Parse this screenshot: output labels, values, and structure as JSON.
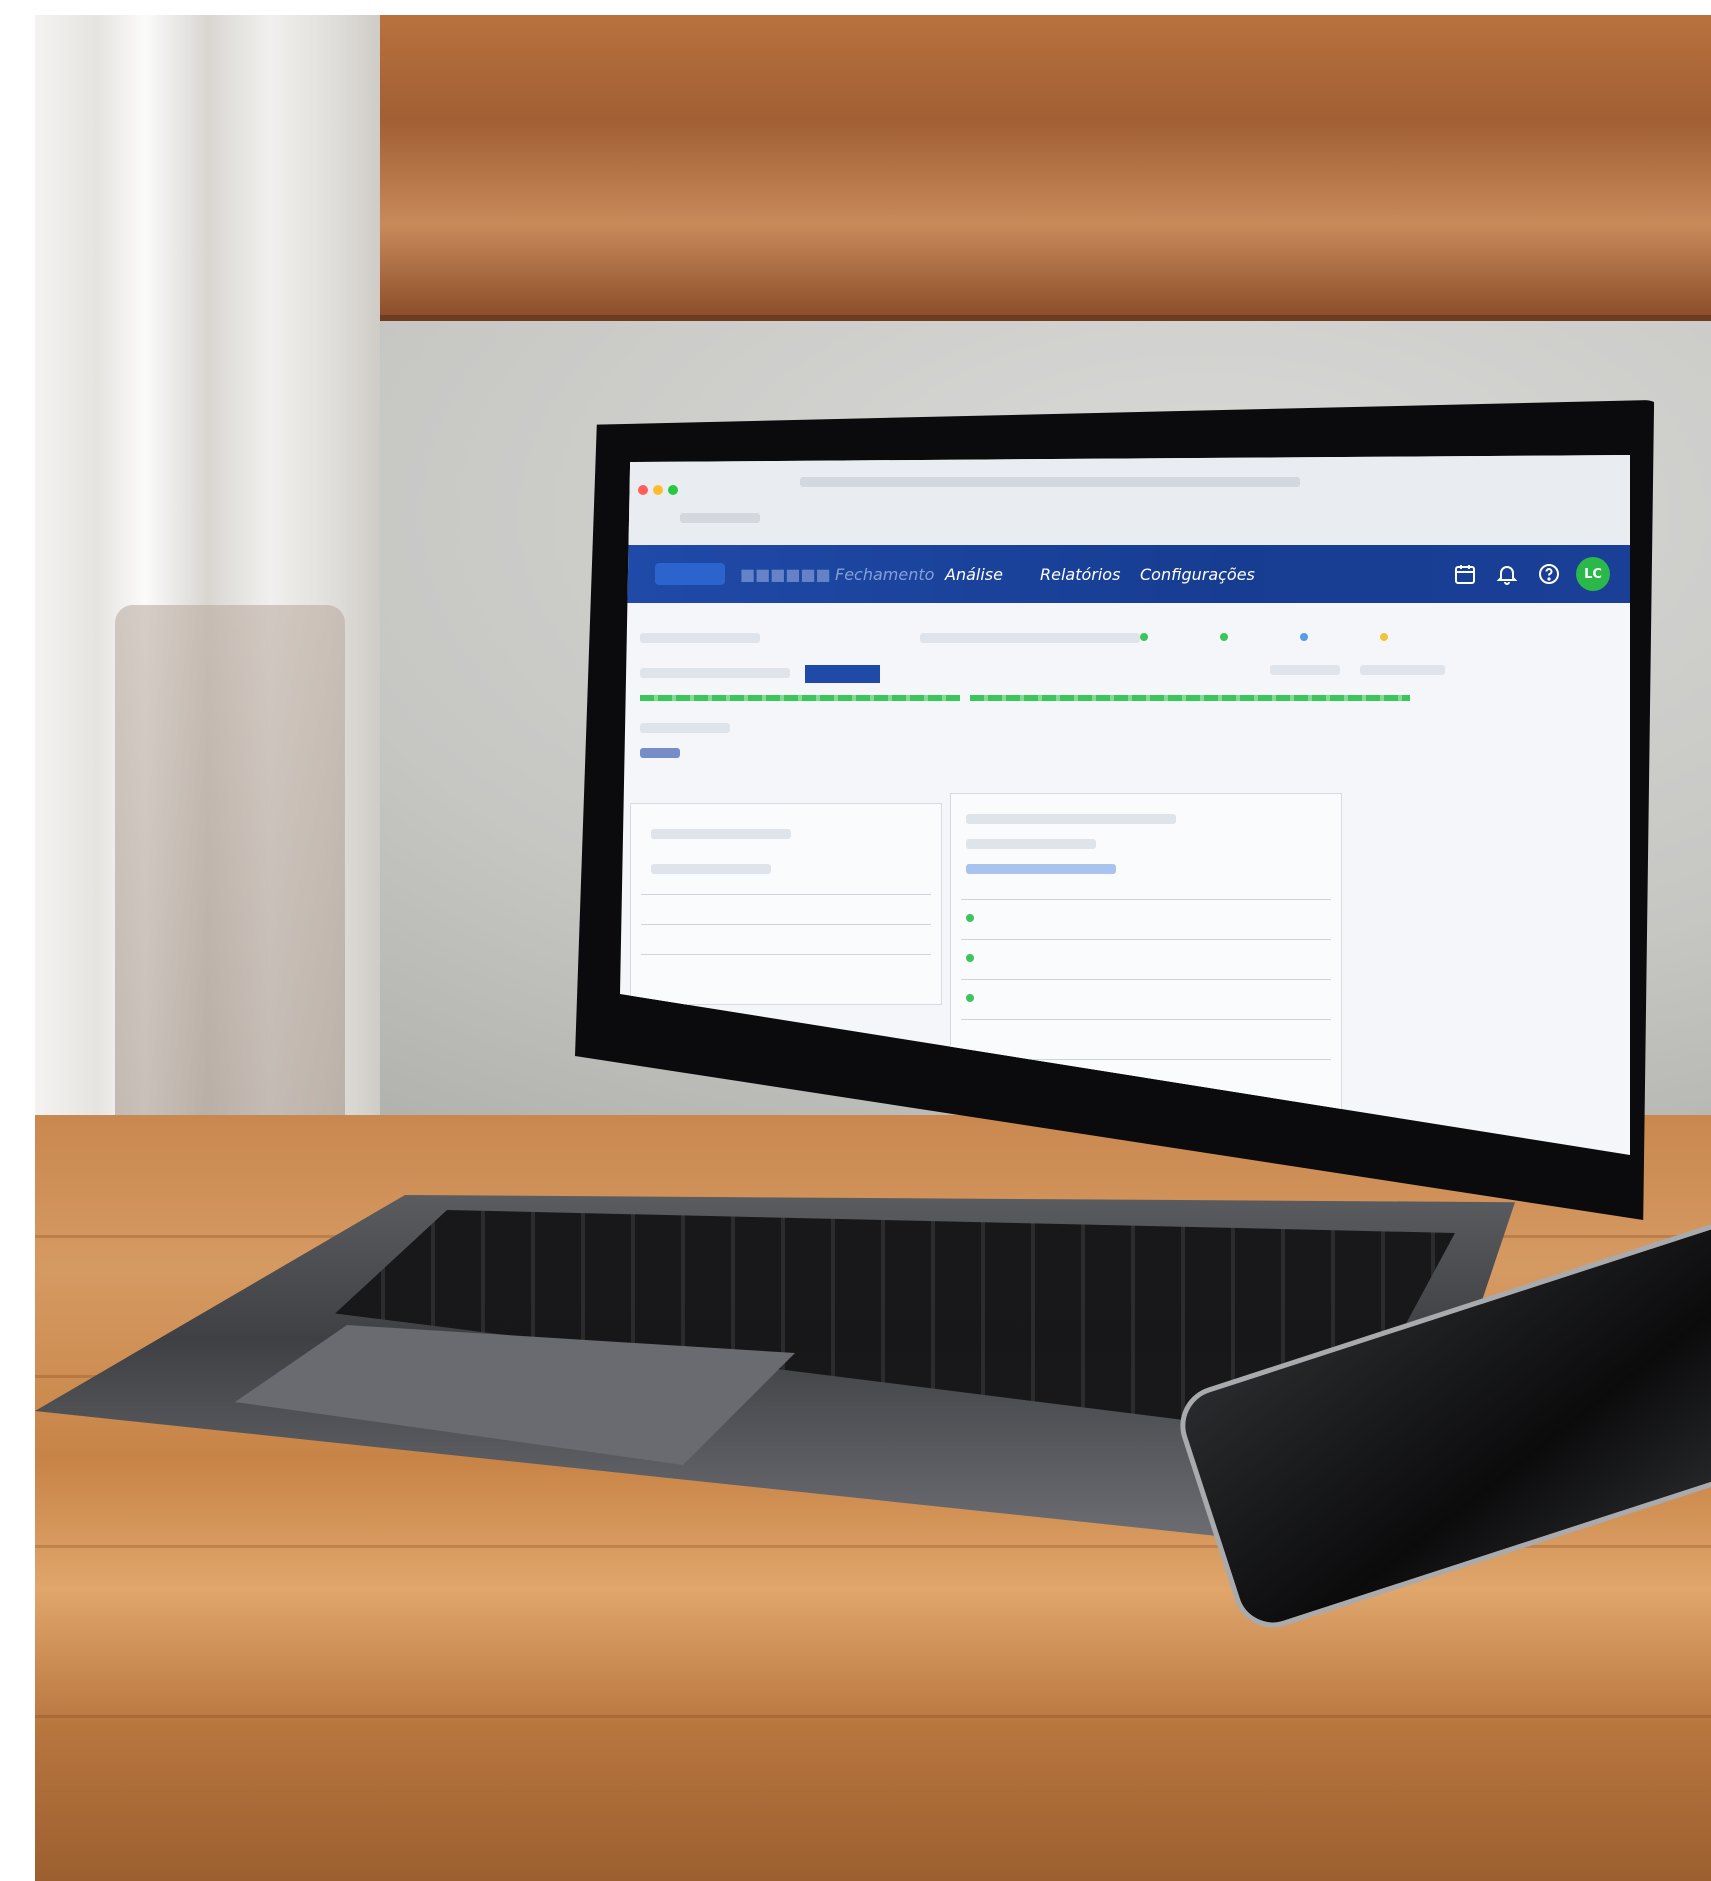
{
  "app": {
    "nav": {
      "item_1": "Fechamento",
      "item_2": "Análise",
      "item_3": "Relatórios",
      "item_4": "Configurações"
    },
    "user_initials": "LC",
    "icons": {
      "calendar": "calendar-icon",
      "bell": "bell-icon",
      "help": "help-icon"
    },
    "colors": {
      "appbar": "#1f4aa8",
      "progress": "#3cc55b",
      "avatar": "#2bb84a"
    }
  }
}
